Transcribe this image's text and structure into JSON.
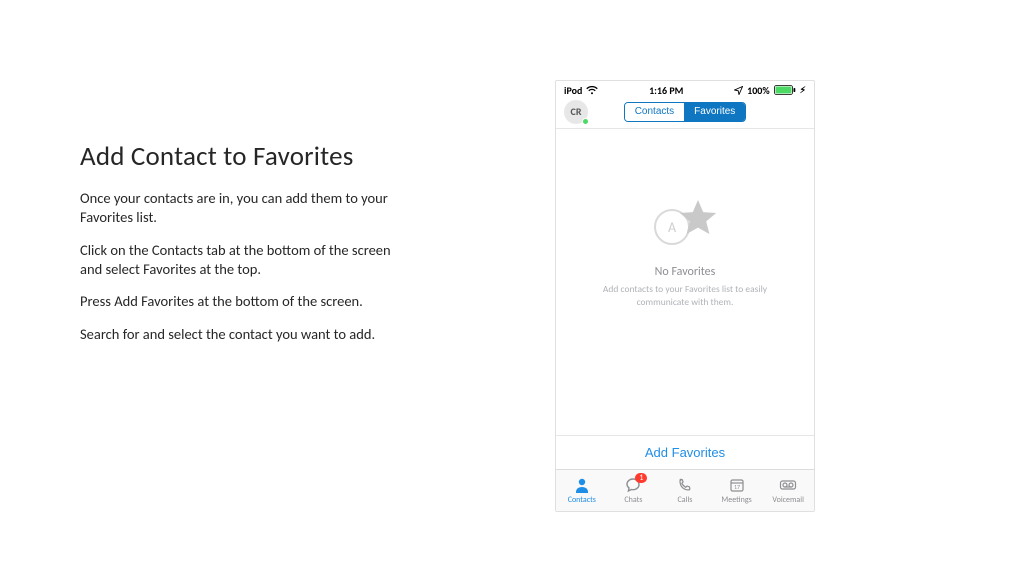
{
  "instructions": {
    "heading": "Add Contact to Favorites",
    "p1": "Once your contacts are in, you can add them to your Favorites list.",
    "p2": "Click on the Contacts tab at the bottom of the screen and select Favorites at the top.",
    "p3": "Press Add Favorites at the bottom of the screen.",
    "p4": "Search for and select the contact you want to add."
  },
  "statusbar": {
    "device": "iPod",
    "time": "1:16 PM",
    "battery_pct": "100%"
  },
  "navbar": {
    "avatar_initials": "CR",
    "seg_contacts": "Contacts",
    "seg_favorites": "Favorites"
  },
  "empty_state": {
    "circle_letter": "A",
    "title": "No Favorites",
    "subtitle": "Add contacts to your Favorites list to easily communicate with them."
  },
  "addbar": {
    "label": "Add Favorites"
  },
  "tabs": {
    "contacts": "Contacts",
    "chats": "Chats",
    "chats_badge": "1",
    "calls": "Calls",
    "meetings": "Meetings",
    "meetings_day": "17",
    "voicemail": "Voicemail"
  }
}
